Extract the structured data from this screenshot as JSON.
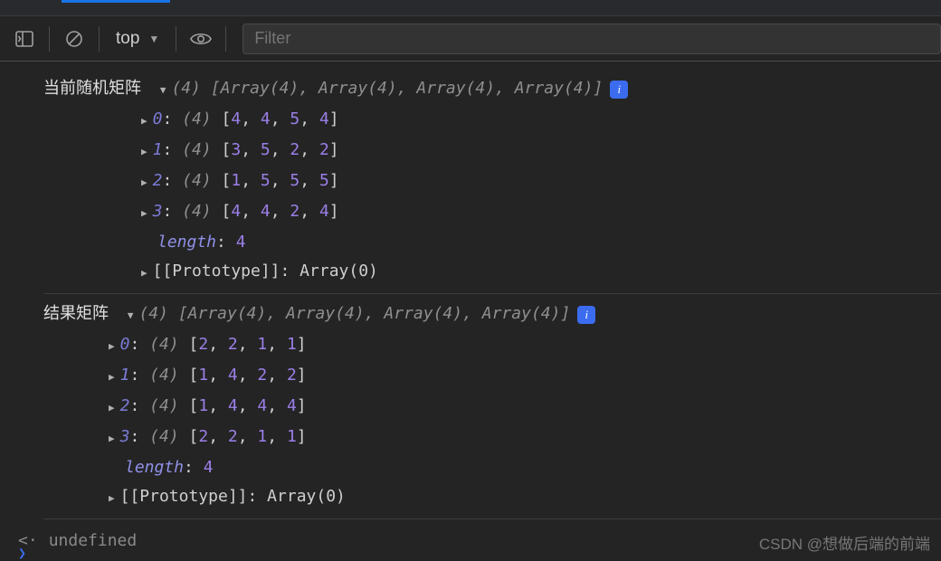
{
  "toolbar": {
    "context": "top",
    "filter_placeholder": "Filter"
  },
  "logs": [
    {
      "label": "当前随机矩阵",
      "length": 4,
      "summary_parts": [
        "Array(4)",
        "Array(4)",
        "Array(4)",
        "Array(4)"
      ],
      "rows": [
        {
          "index": "0",
          "len": "(4)",
          "values": [
            4,
            4,
            5,
            4
          ]
        },
        {
          "index": "1",
          "len": "(4)",
          "values": [
            3,
            5,
            2,
            2
          ]
        },
        {
          "index": "2",
          "len": "(4)",
          "values": [
            1,
            5,
            5,
            5
          ]
        },
        {
          "index": "3",
          "len": "(4)",
          "values": [
            4,
            4,
            2,
            4
          ]
        }
      ],
      "length_label": "length",
      "length_value": "4",
      "prototype_label": "[[Prototype]]",
      "prototype_value": "Array(0)"
    },
    {
      "label": "结果矩阵",
      "length": 4,
      "summary_parts": [
        "Array(4)",
        "Array(4)",
        "Array(4)",
        "Array(4)"
      ],
      "rows": [
        {
          "index": "0",
          "len": "(4)",
          "values": [
            2,
            2,
            1,
            1
          ]
        },
        {
          "index": "1",
          "len": "(4)",
          "values": [
            1,
            4,
            2,
            2
          ]
        },
        {
          "index": "2",
          "len": "(4)",
          "values": [
            1,
            4,
            4,
            4
          ]
        },
        {
          "index": "3",
          "len": "(4)",
          "values": [
            2,
            2,
            1,
            1
          ]
        }
      ],
      "length_label": "length",
      "length_value": "4",
      "prototype_label": "[[Prototype]]",
      "prototype_value": "Array(0)"
    }
  ],
  "return_value": "undefined",
  "watermark": "CSDN @想做后端的前端"
}
